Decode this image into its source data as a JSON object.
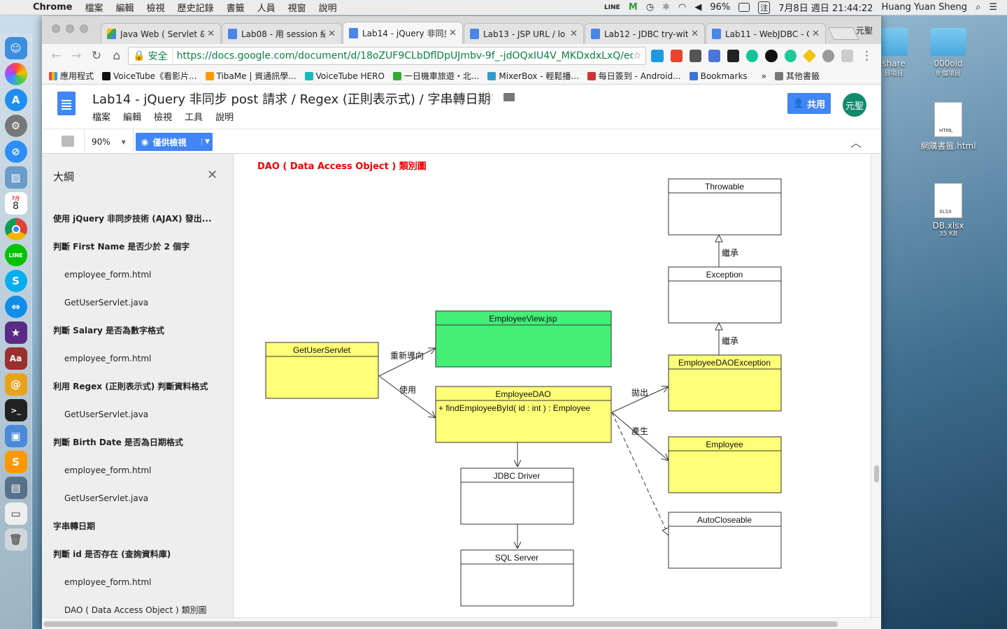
{
  "menubar": {
    "app": "Chrome",
    "items": [
      "檔案",
      "編輯",
      "檢視",
      "歷史記錄",
      "書籤",
      "人員",
      "視窗",
      "說明"
    ],
    "battery": "96%",
    "datetime": "7月8日 週日 21:44:22",
    "user": "Huang Yuan Sheng",
    "input_method": "注"
  },
  "desktop": {
    "items": [
      {
        "label": "share",
        "sublabel": "目項目"
      },
      {
        "label": "000old",
        "sublabel": "8 個項目"
      },
      {
        "label": "網購書籤.html",
        "badge": "HTML"
      },
      {
        "label": "DB.xlsx",
        "sublabel": "35 KB",
        "badge": "XLSX"
      }
    ]
  },
  "dock": {
    "items": [
      "finder-icon",
      "photos-icon",
      "app-store-icon",
      "system-preferences-icon",
      "safari-icon",
      "preview-icon",
      "calendar-icon",
      "chrome-icon",
      "line-icon",
      "skype-icon",
      "teamviewer-icon",
      "imovie-icon",
      "dictionary-icon",
      "eclipse-icon",
      "terminal-icon",
      "virtualbox-icon",
      "sublime-icon",
      "vmware-icon",
      "screenshot-icon",
      "trash-icon"
    ],
    "calendar_month": "7月",
    "calendar_day": "8"
  },
  "browser": {
    "tabs": [
      {
        "title": "Java Web ( Servlet &",
        "icon": "drive"
      },
      {
        "title": "Lab08 - 用 session 紀",
        "icon": "docs"
      },
      {
        "title": "Lab14 - jQuery 非同步",
        "icon": "docs",
        "active": true
      },
      {
        "title": "Lab13 - JSP URL / lo",
        "icon": "docs"
      },
      {
        "title": "Lab12 - JDBC try-wit",
        "icon": "docs"
      },
      {
        "title": "Lab11 - WebJDBC - C",
        "icon": "docs"
      }
    ],
    "profile": "元聖",
    "secure_label": "安全",
    "url": "https://docs.google.com/document/d/18oZUF9CLbDflDpUJmbv-9f_-jdOQxIU4V_MKDxdxLxQ/edit",
    "bookmarks": [
      "應用程式",
      "VoiceTube《看影片...",
      "TibaMe | 資通訊學...",
      "VoiceTube HERO",
      "一日機車旅遊・北...",
      "MixerBox - 輕鬆播...",
      "每日簽到 - Android...",
      "Bookmarks"
    ],
    "bookmarks_more": "»",
    "other_bookmarks": "其他書籤"
  },
  "docs": {
    "title": "Lab14 - jQuery 非同步 post 請求 / Regex (正則表示式) / 字串轉日期",
    "menu": [
      "檔案",
      "編輯",
      "檢視",
      "工具",
      "說明"
    ],
    "share_label": "共用",
    "avatar_text": "元聖",
    "zoom": "90%",
    "mode_label": "僅供檢視"
  },
  "outline": {
    "title": "大綱",
    "items": [
      {
        "text": "使用 jQuery 非同步技術 (AJAX) 發出...",
        "level": 1
      },
      {
        "text": "判斷 First Name 是否少於 2 個字",
        "level": 1
      },
      {
        "text": "employee_form.html",
        "level": 2
      },
      {
        "text": "GetUserServlet.java",
        "level": 2
      },
      {
        "text": "判斷 Salary 是否為數字格式",
        "level": 1
      },
      {
        "text": "employee_form.html",
        "level": 2
      },
      {
        "text": "利用 Regex (正則表示式) 判斷資料格式",
        "level": 1
      },
      {
        "text": "GetUserServlet.java",
        "level": 2
      },
      {
        "text": "判斷 Birth Date 是否為日期格式",
        "level": 1
      },
      {
        "text": "employee_form.html",
        "level": 2
      },
      {
        "text": "GetUserServlet.java",
        "level": 2
      },
      {
        "text": "字串轉日期",
        "level": 1
      },
      {
        "text": "判斷 id 是否存在 (查詢資料庫)",
        "level": 1
      },
      {
        "text": "employee_form.html",
        "level": 2
      },
      {
        "text": "DAO ( Data Access Object ) 類別圖",
        "level": 2
      }
    ]
  },
  "diagram": {
    "heading": "DAO ( Data Access Object ) 類別圖",
    "classes": {
      "throwable": "Throwable",
      "exception": "Exception",
      "employee_dao_exception": "EmployeeDAOException",
      "employee_view": "EmployeeView.jsp",
      "get_user_servlet": "GetUserServlet",
      "employee_dao": "EmployeeDAO",
      "employee_dao_method": "+ findEmployeeById( id : int ) : Employee",
      "employee": "Employee",
      "autocloseable": "AutoCloseable",
      "jdbc_driver": "JDBC Driver",
      "sql_server": "SQL Server"
    },
    "relations": {
      "inherit_1": "繼承",
      "inherit_2": "繼承",
      "redirect": "重新導向",
      "use": "使用",
      "throws": "拋出",
      "produces": "產生"
    },
    "colors": {
      "yellow": "#ffff77",
      "green": "#44ee77"
    }
  }
}
